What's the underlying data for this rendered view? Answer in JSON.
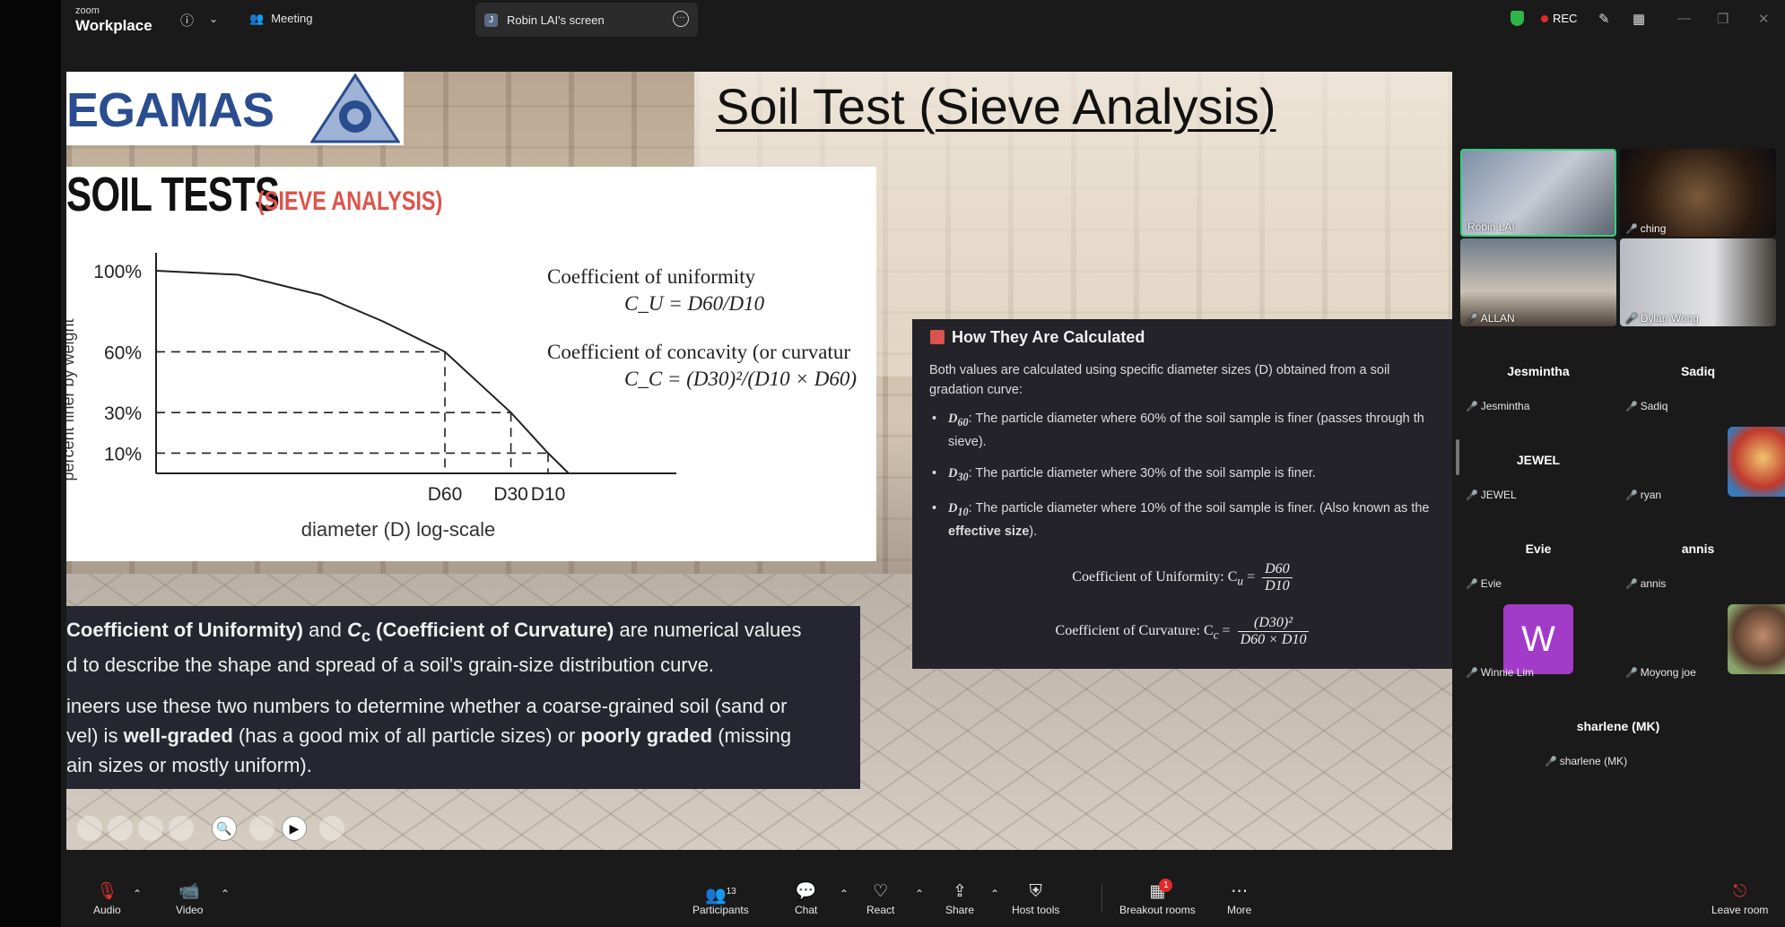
{
  "app": {
    "brand_small": "zoom",
    "brand": "Workplace",
    "meeting_label": "Meeting",
    "shared_screen_tab": "Robin LAI's screen",
    "shared_screen_avatar": "J",
    "rec_label": "REC"
  },
  "slide": {
    "logo_text": "EGAMAS",
    "title": "Soil Test (Sieve Analysis)",
    "soil_heading": "SOIL TESTS",
    "soil_subheading": "(SIEVE ANALYSIS)",
    "chart_ylabel": "percent finer by weight",
    "chart_xlabel": "diameter (D) log-scale",
    "cu_label": "Coefficient of uniformity",
    "cu_formula": "C_U = D60/D10",
    "cc_label": "Coefficient of concavity (or curvatur",
    "cc_formula": "C_C = (D30)²/(D10 × D60)",
    "dark_para1_a": "Coefficient of Uniformity)",
    "dark_para1_b": " and ",
    "dark_para1_c": "C",
    "dark_para1_d": "c",
    "dark_para1_e": " (Coefficient of Curvature)",
    "dark_para1_f": " are numerical values",
    "dark_para1_line2": "d to describe the shape and spread of a soil's grain-size distribution curve.",
    "dark_para2_line1": "ineers use these two numbers to determine whether a coarse-grained soil (sand or",
    "dark_para2_line2_a": "vel) is ",
    "dark_para2_line2_b": "well-graded",
    "dark_para2_line2_c": " (has a good mix of all particle sizes) or ",
    "dark_para2_line2_d": "poorly graded",
    "dark_para2_line2_e": " (missing",
    "dark_para2_line3": "ain sizes or mostly uniform).",
    "calc_heading": "How They Are Calculated",
    "calc_intro": "Both values are calculated using specific diameter sizes (D) obtained from a soil gradation curve:",
    "calc_items": [
      {
        "sym": "D",
        "sub": "60",
        "text": ": The particle diameter where 60% of the soil sample is finer (passes through th",
        "text2": "sieve)."
      },
      {
        "sym": "D",
        "sub": "30",
        "text": ": The particle diameter where 30% of the soil sample is finer.",
        "text2": ""
      },
      {
        "sym": "D",
        "sub": "10",
        "text": ": The particle diameter where 10% of the soil sample is finer. (Also known as the",
        "text2": "effective size",
        "text3": ")."
      }
    ],
    "eq1_label": "Coefficient of Uniformity: C",
    "eq1_sub": "u",
    "eq1_num": "D60",
    "eq1_den": "D10",
    "eq2_label": "Coefficient of Curvature: C",
    "eq2_sub": "c",
    "eq2_num": "(D30)²",
    "eq2_den": "D60 × D10"
  },
  "chart_data": {
    "type": "line",
    "title": "",
    "xlabel": "diameter (D) log-scale",
    "ylabel": "percent finer by weight",
    "y_ticks": [
      "100%",
      "60%",
      "30%",
      "10%"
    ],
    "x_ticks": [
      "D60",
      "D30",
      "D10"
    ],
    "series": [
      {
        "x": [
          0.0,
          0.2,
          0.4,
          0.55,
          0.7,
          0.78,
          0.86,
          0.95,
          1.0
        ],
        "y": [
          100,
          98,
          88,
          75,
          60,
          45,
          30,
          10,
          0
        ]
      }
    ],
    "grid": false
  },
  "participants": {
    "video_tiles": [
      {
        "name": "Robin LAI",
        "muted": false,
        "active": true
      },
      {
        "name": "ching",
        "muted": true,
        "active": false
      },
      {
        "name": "ALLAN",
        "muted": true,
        "active": false
      },
      {
        "name": "Dylan Wong",
        "muted": true,
        "active": false
      }
    ],
    "name_tiles": [
      {
        "big": "Jesmintha",
        "small": "Jesmintha"
      },
      {
        "big": "Sadiq",
        "small": "Sadiq"
      },
      {
        "big": "JEWEL",
        "small": "JEWEL"
      },
      {
        "big": "",
        "small": "ryan"
      },
      {
        "big": "Evie",
        "small": "Evie"
      },
      {
        "big": "annis",
        "small": "annis"
      },
      {
        "big": "W",
        "small": "Winnie Lim"
      },
      {
        "big": "",
        "small": "Moyong joe"
      },
      {
        "big": "sharlene (MK)",
        "small": "sharlene (MK)"
      }
    ]
  },
  "toolbar": {
    "audio": "Audio",
    "video": "Video",
    "participants": "Participants",
    "participants_count": "13",
    "chat": "Chat",
    "react": "React",
    "share": "Share",
    "host_tools": "Host tools",
    "breakout_rooms": "Breakout rooms",
    "breakout_badge": "1",
    "more": "More",
    "leave_room": "Leave room"
  },
  "colors": {
    "accent_green": "#2fb54a",
    "rec_red": "#e02a2a",
    "dark_panel": "#262631"
  }
}
